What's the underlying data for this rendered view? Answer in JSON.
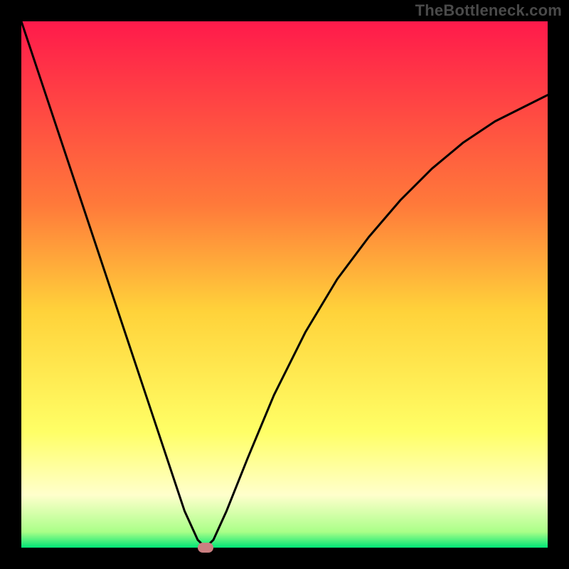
{
  "watermark": "TheBottleneck.com",
  "chart_data": {
    "type": "line",
    "title": "",
    "xlabel": "",
    "ylabel": "",
    "xlim": [
      0,
      100
    ],
    "ylim": [
      0,
      100
    ],
    "gradient_stops": [
      {
        "offset": 0,
        "color": "#ff1a4b"
      },
      {
        "offset": 35,
        "color": "#ff7a3a"
      },
      {
        "offset": 55,
        "color": "#ffd23a"
      },
      {
        "offset": 78,
        "color": "#ffff66"
      },
      {
        "offset": 90,
        "color": "#ffffcc"
      },
      {
        "offset": 97,
        "color": "#aaff88"
      },
      {
        "offset": 100,
        "color": "#00e676"
      }
    ],
    "series": [
      {
        "name": "bottleneck-curve",
        "x": [
          0,
          4,
          8,
          12,
          16,
          20,
          24,
          28,
          31,
          33.5,
          35,
          36.5,
          39,
          43,
          48,
          54,
          60,
          66,
          72,
          78,
          84,
          90,
          96,
          100
        ],
        "y": [
          100,
          88,
          76,
          64,
          52,
          40,
          28,
          16,
          7,
          1.5,
          0,
          1.5,
          7,
          17,
          29,
          41,
          51,
          59,
          66,
          72,
          77,
          81,
          84,
          86
        ]
      }
    ],
    "marker": {
      "x": 35,
      "y": 0
    }
  }
}
